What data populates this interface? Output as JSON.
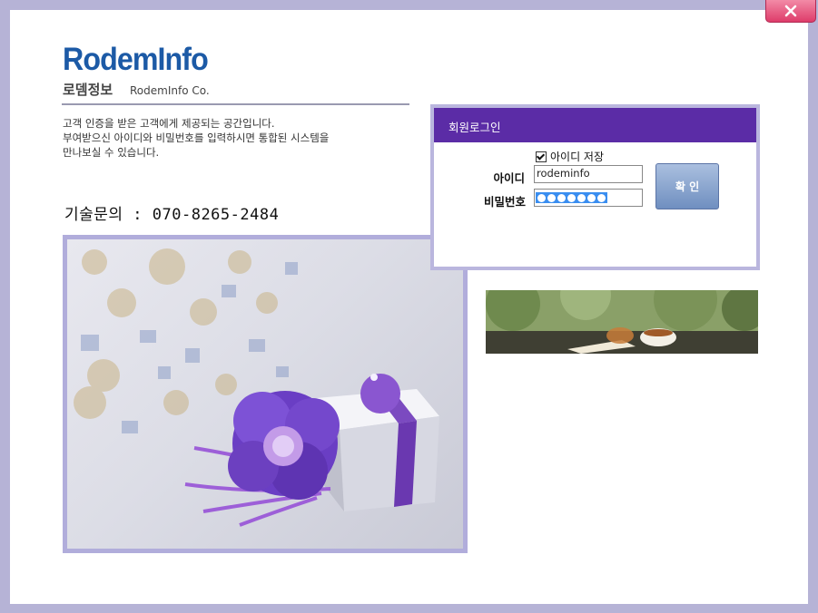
{
  "window": {
    "close_icon": "close-icon",
    "accent_color": "#5b2ca6"
  },
  "brand": {
    "logo": "RodemInfo",
    "name_kr": "로뎀정보",
    "name_en": "RodemInfo Co."
  },
  "intro": {
    "lines": [
      "고객 인증을 받은 고객에게 제공되는 공간입니다.",
      "부여받으신 아이디와 비밀번호를 입력하시면 통합된 시스템을",
      "만나보실 수 있습니다."
    ]
  },
  "tech_support": "기술문의 : 070-8265-2484",
  "login": {
    "title": "회원로그인",
    "save_id_label": "아이디 저장",
    "save_id_checked": true,
    "id_label": "아이디",
    "id_value": "rodeminfo",
    "pw_label": "비밀번호",
    "pw_mask_count": 7,
    "confirm_label": "확 인"
  },
  "images": {
    "gift": "gift-box-with-purple-flower-image",
    "banner": "tea-cup-and-book-outdoor-banner"
  }
}
